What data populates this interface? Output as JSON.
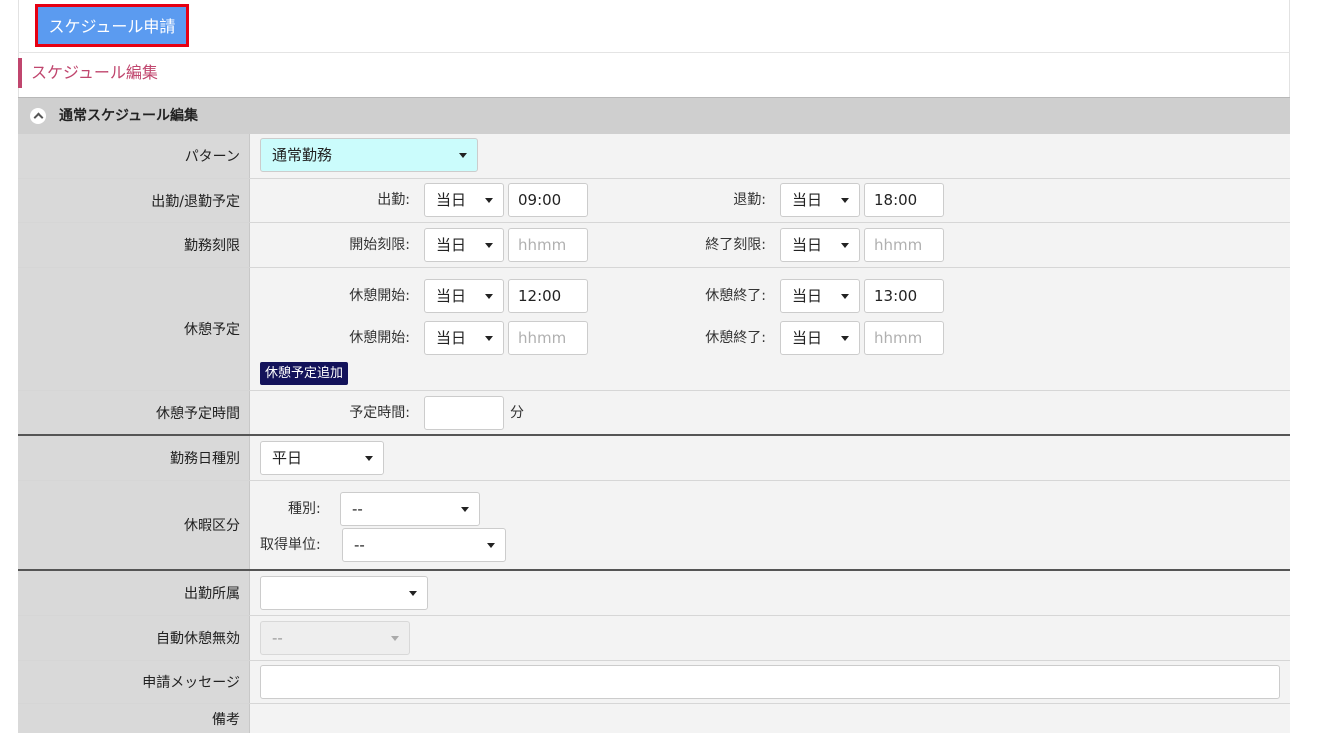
{
  "toolbar": {
    "submit_label": "スケジュール申請"
  },
  "section_title": "スケジュール編集",
  "panel_title": "通常スケジュール編集",
  "rows": {
    "pattern": {
      "label": "パターン",
      "value": "通常勤務"
    },
    "attendance": {
      "label": "出勤/退勤予定",
      "start_label": "出勤:",
      "start_day": "当日",
      "start_time": "09:00",
      "end_label": "退勤:",
      "end_day": "当日",
      "end_time": "18:00"
    },
    "work_limit": {
      "label": "勤務刻限",
      "start_label": "開始刻限:",
      "start_day": "当日",
      "start_placeholder": "hhmm",
      "end_label": "終了刻限:",
      "end_day": "当日",
      "end_placeholder": "hhmm"
    },
    "break_plan": {
      "label": "休憩予定",
      "break1": {
        "start_label": "休憩開始:",
        "start_day": "当日",
        "start_time": "12:00",
        "end_label": "休憩終了:",
        "end_day": "当日",
        "end_time": "13:00"
      },
      "break2": {
        "start_label": "休憩開始:",
        "start_day": "当日",
        "start_placeholder": "hhmm",
        "end_label": "休憩終了:",
        "end_day": "当日",
        "end_placeholder": "hhmm"
      },
      "add_button": "休憩予定追加"
    },
    "break_duration": {
      "label": "休憩予定時間",
      "field_label": "予定時間:",
      "value": "",
      "unit": "分"
    },
    "workday_type": {
      "label": "勤務日種別",
      "value": "平日"
    },
    "leave": {
      "label": "休暇区分",
      "type_label": "種別:",
      "type_value": "--",
      "unit_label": "取得単位:",
      "unit_value": "--"
    },
    "affiliation": {
      "label": "出勤所属",
      "value": ""
    },
    "auto_break": {
      "label": "自動休憩無効",
      "value": "--"
    },
    "message": {
      "label": "申請メッセージ",
      "value": ""
    },
    "remarks": {
      "label": "備考"
    }
  }
}
